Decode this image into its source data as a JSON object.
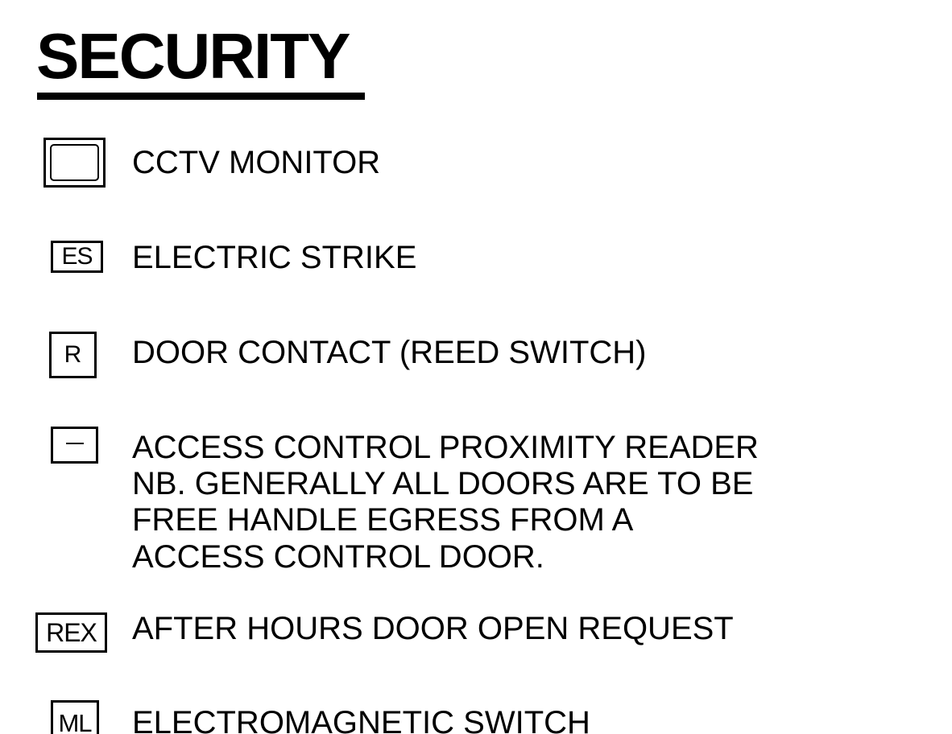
{
  "title": "SECURITY",
  "legend": [
    {
      "symbol_icon": "cctv-monitor-icon",
      "symbol_text": "",
      "label": "CCTV MONITOR"
    },
    {
      "symbol_icon": "electric-strike-icon",
      "symbol_text": "ES",
      "label": "ELECTRIC STRIKE"
    },
    {
      "symbol_icon": "door-contact-icon",
      "symbol_text": "R",
      "label": "DOOR CONTACT (REED SWITCH)"
    },
    {
      "symbol_icon": "proximity-reader-icon",
      "symbol_text": "",
      "label": "ACCESS CONTROL PROXIMITY READER",
      "note_lines": [
        "NB. GENERALLY ALL DOORS ARE TO BE",
        "FREE HANDLE EGRESS FROM A",
        "ACCESS CONTROL DOOR."
      ]
    },
    {
      "symbol_icon": "rex-button-icon",
      "symbol_text": "REX",
      "label": "AFTER HOURS DOOR OPEN REQUEST"
    },
    {
      "symbol_icon": "magnetic-lock-icon",
      "symbol_text": "ML",
      "label": "ELECTROMAGNETIC SWITCH"
    }
  ]
}
